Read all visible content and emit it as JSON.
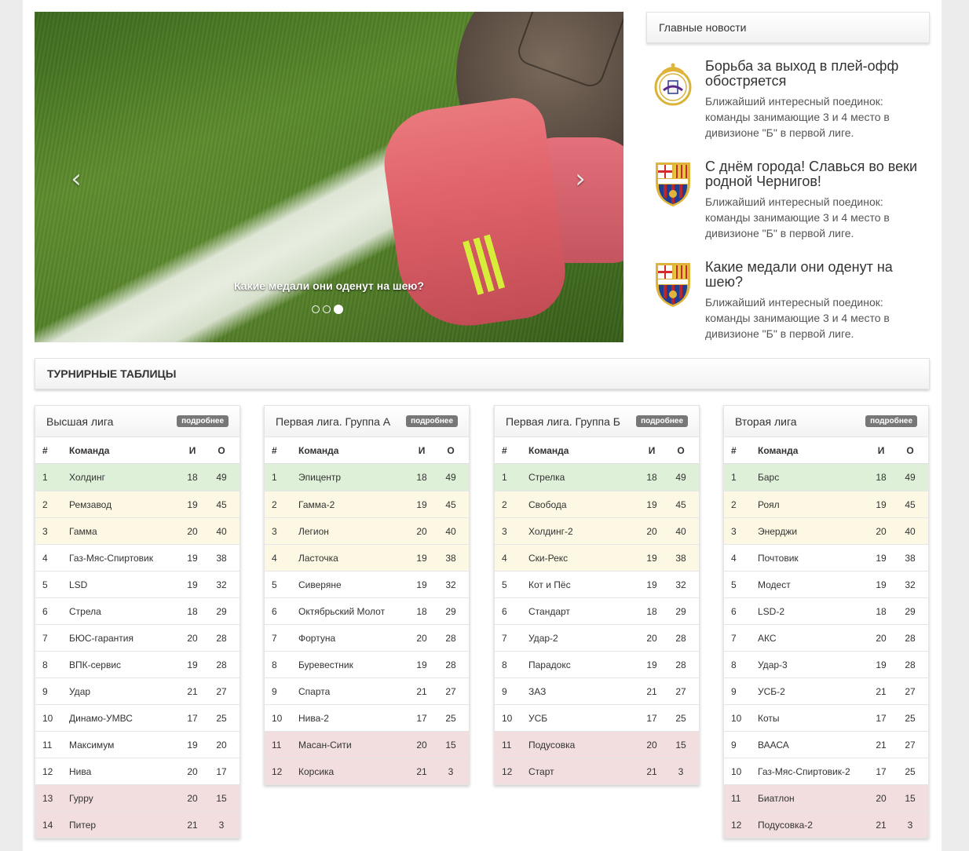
{
  "slider": {
    "caption": "Какие медали они оденут на шею?",
    "prev_icon": "‹",
    "next_icon": "›",
    "slide_count": 3,
    "active_slide": 3
  },
  "news": {
    "heading": "Главные новости",
    "items": [
      {
        "logo": "real-madrid-crest-icon",
        "title": "Борьба за выход в плей-офф обостряется",
        "text": "Ближайший интересный поединок: команды занимающие 3 и 4 место в дивизионе \"Б\" в первой лиге."
      },
      {
        "logo": "fc-barcelona-crest-icon",
        "title": "С днём города! Славься во веки родной Чернигов!",
        "text": "Ближайший интересный поединок: команды занимающие 3 и 4 место в дивизионе \"Б\" в первой лиге."
      },
      {
        "logo": "fc-barcelona-crest-icon",
        "title": "Какие медали они оденут на шею?",
        "text": "Ближайший интересный поединок: команды занимающие 3 и 4 место в дивизионе \"Б\" в первой лиге."
      }
    ]
  },
  "tables": {
    "heading": "ТУРНИРНЫЕ ТАБЛИЦЫ",
    "columns": {
      "num": "#",
      "team": "Команда",
      "games": "И",
      "points": "О"
    },
    "more_label": "подробнее",
    "leagues": [
      {
        "name": "Высшая лига",
        "rows": [
          {
            "num": "1",
            "team": "Холдинг",
            "games": "18",
            "points": "49",
            "status": "green"
          },
          {
            "num": "2",
            "team": "Ремзавод",
            "games": "19",
            "points": "45",
            "status": "yellow"
          },
          {
            "num": "3",
            "team": "Гамма",
            "games": "20",
            "points": "40",
            "status": "yellow"
          },
          {
            "num": "4",
            "team": "Газ-Мяс-Спиртовик",
            "games": "19",
            "points": "38",
            "status": ""
          },
          {
            "num": "5",
            "team": "LSD",
            "games": "19",
            "points": "32",
            "status": ""
          },
          {
            "num": "6",
            "team": "Стрела",
            "games": "18",
            "points": "29",
            "status": ""
          },
          {
            "num": "7",
            "team": "БЮС-гарантия",
            "games": "20",
            "points": "28",
            "status": ""
          },
          {
            "num": "8",
            "team": "ВПК-сервис",
            "games": "19",
            "points": "28",
            "status": ""
          },
          {
            "num": "9",
            "team": "Удар",
            "games": "21",
            "points": "27",
            "status": ""
          },
          {
            "num": "10",
            "team": "Динамо-УМВС",
            "games": "17",
            "points": "25",
            "status": ""
          },
          {
            "num": "11",
            "team": "Максимум",
            "games": "19",
            "points": "20",
            "status": ""
          },
          {
            "num": "12",
            "team": "Нива",
            "games": "20",
            "points": "17",
            "status": ""
          },
          {
            "num": "13",
            "team": "Гурру",
            "games": "20",
            "points": "15",
            "status": "red"
          },
          {
            "num": "14",
            "team": "Питер",
            "games": "21",
            "points": "3",
            "status": "red"
          }
        ]
      },
      {
        "name": "Первая лига. Группа А",
        "rows": [
          {
            "num": "1",
            "team": "Эпицентр",
            "games": "18",
            "points": "49",
            "status": "green"
          },
          {
            "num": "2",
            "team": "Гамма-2",
            "games": "19",
            "points": "45",
            "status": "yellow"
          },
          {
            "num": "3",
            "team": "Легион",
            "games": "20",
            "points": "40",
            "status": "yellow"
          },
          {
            "num": "4",
            "team": "Ласточка",
            "games": "19",
            "points": "38",
            "status": "yellow"
          },
          {
            "num": "5",
            "team": "Сиверяне",
            "games": "19",
            "points": "32",
            "status": ""
          },
          {
            "num": "6",
            "team": "Октябрьский Молот",
            "games": "18",
            "points": "29",
            "status": ""
          },
          {
            "num": "7",
            "team": "Фортуна",
            "games": "20",
            "points": "28",
            "status": ""
          },
          {
            "num": "8",
            "team": "Буревестник",
            "games": "19",
            "points": "28",
            "status": ""
          },
          {
            "num": "9",
            "team": "Спарта",
            "games": "21",
            "points": "27",
            "status": ""
          },
          {
            "num": "10",
            "team": "Нива-2",
            "games": "17",
            "points": "25",
            "status": ""
          },
          {
            "num": "11",
            "team": "Масан-Сити",
            "games": "20",
            "points": "15",
            "status": "red"
          },
          {
            "num": "12",
            "team": "Корсика",
            "games": "21",
            "points": "3",
            "status": "red"
          }
        ]
      },
      {
        "name": "Первая лига. Группа Б",
        "rows": [
          {
            "num": "1",
            "team": "Стрелка",
            "games": "18",
            "points": "49",
            "status": "green"
          },
          {
            "num": "2",
            "team": "Свобода",
            "games": "19",
            "points": "45",
            "status": "yellow"
          },
          {
            "num": "3",
            "team": "Холдинг-2",
            "games": "20",
            "points": "40",
            "status": "yellow"
          },
          {
            "num": "4",
            "team": "Ски-Рекс",
            "games": "19",
            "points": "38",
            "status": "yellow"
          },
          {
            "num": "5",
            "team": "Кот и Пёс",
            "games": "19",
            "points": "32",
            "status": ""
          },
          {
            "num": "6",
            "team": "Стандарт",
            "games": "18",
            "points": "29",
            "status": ""
          },
          {
            "num": "7",
            "team": "Удар-2",
            "games": "20",
            "points": "28",
            "status": ""
          },
          {
            "num": "8",
            "team": "Парадокс",
            "games": "19",
            "points": "28",
            "status": ""
          },
          {
            "num": "9",
            "team": "ЗАЗ",
            "games": "21",
            "points": "27",
            "status": ""
          },
          {
            "num": "10",
            "team": "УСБ",
            "games": "17",
            "points": "25",
            "status": ""
          },
          {
            "num": "11",
            "team": "Подусовка",
            "games": "20",
            "points": "15",
            "status": "red"
          },
          {
            "num": "12",
            "team": "Старт",
            "games": "21",
            "points": "3",
            "status": "red"
          }
        ]
      },
      {
        "name": "Вторая лига",
        "rows": [
          {
            "num": "1",
            "team": "Барс",
            "games": "18",
            "points": "49",
            "status": "green"
          },
          {
            "num": "2",
            "team": "Роял",
            "games": "19",
            "points": "45",
            "status": "yellow"
          },
          {
            "num": "3",
            "team": "Энерджи",
            "games": "20",
            "points": "40",
            "status": "yellow"
          },
          {
            "num": "4",
            "team": "Почтовик",
            "games": "19",
            "points": "38",
            "status": ""
          },
          {
            "num": "5",
            "team": "Модест",
            "games": "19",
            "points": "32",
            "status": ""
          },
          {
            "num": "6",
            "team": "LSD-2",
            "games": "18",
            "points": "29",
            "status": ""
          },
          {
            "num": "7",
            "team": "АКС",
            "games": "20",
            "points": "28",
            "status": ""
          },
          {
            "num": "8",
            "team": "Удар-3",
            "games": "19",
            "points": "28",
            "status": ""
          },
          {
            "num": "9",
            "team": "УСБ-2",
            "games": "21",
            "points": "27",
            "status": ""
          },
          {
            "num": "10",
            "team": "Коты",
            "games": "17",
            "points": "25",
            "status": ""
          },
          {
            "num": "9",
            "team": "ВААСА",
            "games": "21",
            "points": "27",
            "status": ""
          },
          {
            "num": "10",
            "team": "Газ-Мяс-Спиртовик-2",
            "games": "17",
            "points": "25",
            "status": ""
          },
          {
            "num": "11",
            "team": "Биатлон",
            "games": "20",
            "points": "15",
            "status": "red"
          },
          {
            "num": "12",
            "team": "Подусовка-2",
            "games": "21",
            "points": "3",
            "status": "red"
          }
        ]
      }
    ]
  },
  "colors": {
    "row_green": "#dff0d8",
    "row_yellow": "#fcf8e3",
    "row_red": "#f2dede",
    "badge": "#777777"
  }
}
